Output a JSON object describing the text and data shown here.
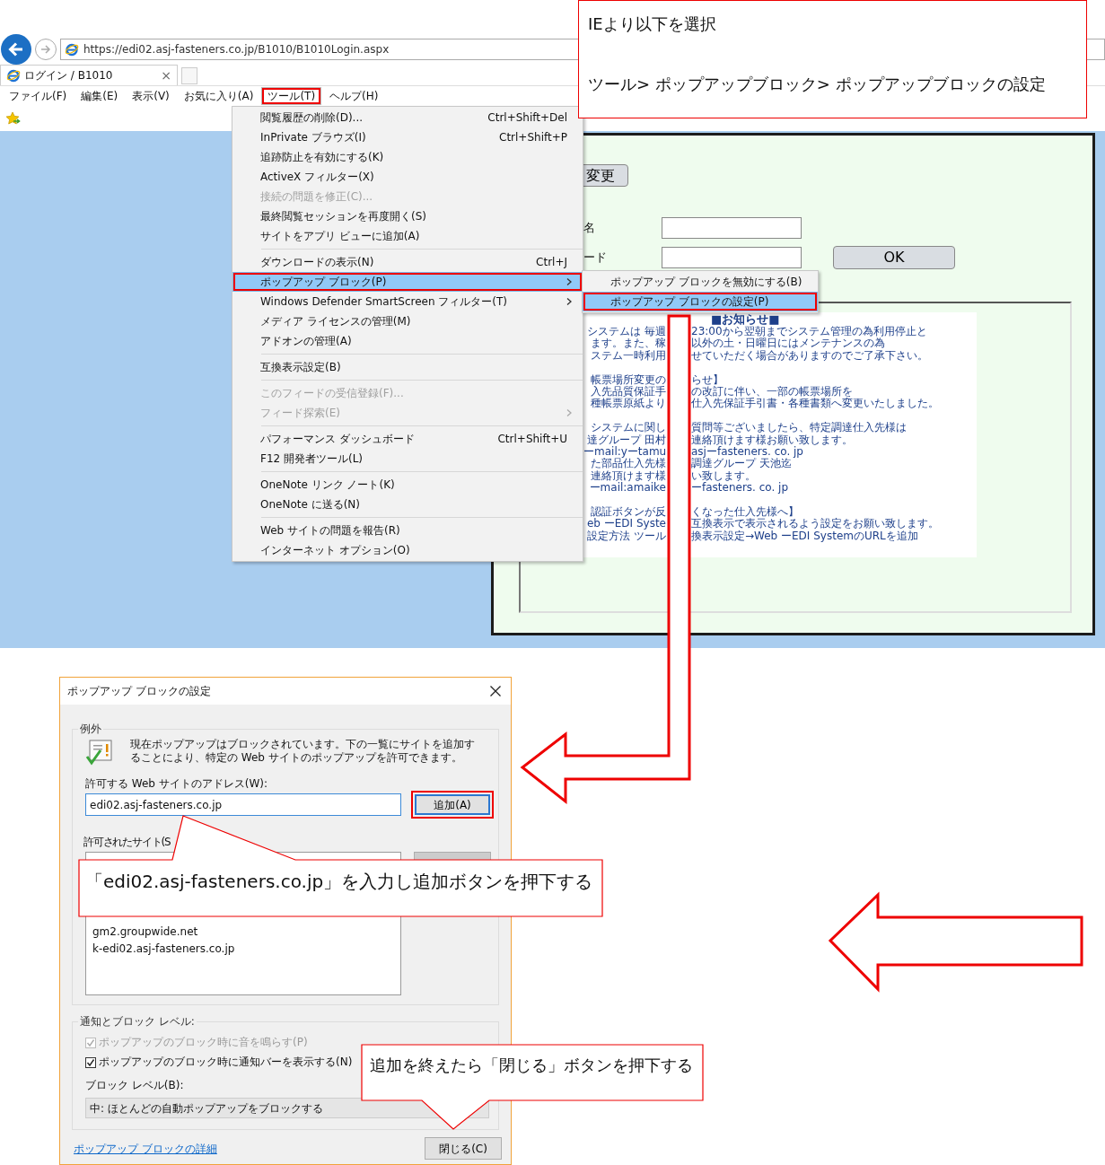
{
  "browser": {
    "address": "https://edi02.asj-fasteners.co.jp/B1010/B1010Login.aspx",
    "tab": {
      "title": "ログイン / B1010",
      "close": "×"
    },
    "menubar": [
      {
        "label": "ファイル(F)",
        "selected": false,
        "annotated": false
      },
      {
        "label": "編集(E)",
        "selected": false,
        "annotated": false
      },
      {
        "label": "表示(V)",
        "selected": false,
        "annotated": false
      },
      {
        "label": "お気に入り(A)",
        "selected": false,
        "annotated": false
      },
      {
        "label": "ツール(T)",
        "selected": true,
        "annotated": true
      },
      {
        "label": "ヘルプ(H)",
        "selected": false,
        "annotated": false
      }
    ],
    "tools_menu": [
      {
        "kind": "item",
        "label": "閲覧履歴の削除(D)...",
        "shortcut": "Ctrl+Shift+Del",
        "disabled": false,
        "selected": false,
        "submenu": false,
        "annotated": false
      },
      {
        "kind": "item",
        "label": "InPrivate ブラウズ(I)",
        "shortcut": "Ctrl+Shift+P",
        "disabled": false,
        "selected": false,
        "submenu": false,
        "annotated": false
      },
      {
        "kind": "item",
        "label": "追跡防止を有効にする(K)",
        "disabled": false,
        "selected": false,
        "submenu": false,
        "annotated": false
      },
      {
        "kind": "item",
        "label": "ActiveX フィルター(X)",
        "disabled": false,
        "selected": false,
        "submenu": false,
        "annotated": false
      },
      {
        "kind": "item",
        "label": "接続の問題を修正(C)...",
        "disabled": true,
        "selected": false,
        "submenu": false,
        "annotated": false
      },
      {
        "kind": "item",
        "label": "最終閲覧セッションを再度開く(S)",
        "disabled": false,
        "selected": false,
        "submenu": false,
        "annotated": false
      },
      {
        "kind": "item",
        "label": "サイトをアプリ ビューに追加(A)",
        "disabled": false,
        "selected": false,
        "submenu": false,
        "annotated": false
      },
      {
        "kind": "separator"
      },
      {
        "kind": "item",
        "label": "ダウンロードの表示(N)",
        "shortcut": "Ctrl+J",
        "disabled": false,
        "selected": false,
        "submenu": false,
        "annotated": false
      },
      {
        "kind": "item",
        "label": "ポップアップ ブロック(P)",
        "disabled": false,
        "selected": true,
        "submenu": true,
        "annotated": true
      },
      {
        "kind": "item",
        "label": "Windows Defender SmartScreen フィルター(T)",
        "disabled": false,
        "selected": false,
        "submenu": true,
        "annotated": false
      },
      {
        "kind": "item",
        "label": "メディア ライセンスの管理(M)",
        "disabled": false,
        "selected": false,
        "submenu": false,
        "annotated": false
      },
      {
        "kind": "item",
        "label": "アドオンの管理(A)",
        "disabled": false,
        "selected": false,
        "submenu": false,
        "annotated": false
      },
      {
        "kind": "separator"
      },
      {
        "kind": "item",
        "label": "互換表示設定(B)",
        "disabled": false,
        "selected": false,
        "submenu": false,
        "annotated": false
      },
      {
        "kind": "separator"
      },
      {
        "kind": "item",
        "label": "このフィードの受信登録(F)...",
        "disabled": true,
        "selected": false,
        "submenu": false,
        "annotated": false
      },
      {
        "kind": "item",
        "label": "フィード探索(E)",
        "disabled": true,
        "selected": false,
        "submenu": true,
        "annotated": false
      },
      {
        "kind": "separator"
      },
      {
        "kind": "item",
        "label": "パフォーマンス ダッシュボード",
        "shortcut": "Ctrl+Shift+U",
        "disabled": false,
        "selected": false,
        "submenu": false,
        "annotated": false
      },
      {
        "kind": "item",
        "label": "F12 開発者ツール(L)",
        "disabled": false,
        "selected": false,
        "submenu": false,
        "annotated": false
      },
      {
        "kind": "separator"
      },
      {
        "kind": "item",
        "label": "OneNote リンク ノート(K)",
        "disabled": false,
        "selected": false,
        "submenu": false,
        "annotated": false
      },
      {
        "kind": "item",
        "label": "OneNote に送る(N)",
        "disabled": false,
        "selected": false,
        "submenu": false,
        "annotated": false
      },
      {
        "kind": "separator"
      },
      {
        "kind": "item",
        "label": "Web サイトの問題を報告(R)",
        "disabled": false,
        "selected": false,
        "submenu": false,
        "annotated": false
      },
      {
        "kind": "item",
        "label": "インターネット オプション(O)",
        "disabled": false,
        "selected": false,
        "submenu": false,
        "annotated": false
      }
    ],
    "popup_submenu": [
      {
        "kind": "item",
        "label": "ポップアップ ブロックを無効にする(B)",
        "disabled": false,
        "selected": false,
        "submenu": false,
        "annotated": false
      },
      {
        "kind": "item",
        "label": "ポップアップ ブロックの設定(P)",
        "disabled": false,
        "selected": true,
        "submenu": false,
        "annotated": true
      }
    ]
  },
  "login_panel": {
    "change_button": "変更",
    "fields": [
      {
        "label": "名"
      },
      {
        "label": "ード"
      }
    ],
    "ok_button": "OK",
    "notice": {
      "title": "■お知らせ■",
      "paragraphs": [
        [
          {
            "left": "システムは 毎週",
            "right": "23:00から翌朝までシステム管理の為利用停止と"
          },
          {
            "left": "ます。また、稼",
            "right": "以外の土・日曜日にはメンテナンスの為"
          },
          {
            "left": "ステム一時利用",
            "right": "せていただく場合がありますのでご了承下さい。"
          }
        ],
        [
          {
            "left": "帳票場所変更の",
            "right": "らせ】"
          },
          {
            "left": "入先品質保証手",
            "right": "の改訂に伴い、一部の帳票場所を"
          },
          {
            "left": "種帳票原紙より",
            "right": "仕入先保証手引書・各種書類へ変更いたしました。"
          }
        ],
        [
          {
            "left": "システムに関し",
            "right": "質問等ございましたら、特定調達仕入先様は"
          },
          {
            "left": "達グループ 田村",
            "right": "連絡頂けます様お願い致します。"
          },
          {
            "left": "ーmail:yーtamu",
            "right": "asjーfasteners. co. jp"
          },
          {
            "left": "た部品仕入先様",
            "right": "調達グループ 天池迄"
          },
          {
            "left": "連絡頂けます様",
            "right": "い致します。"
          },
          {
            "left": "ーmail:amaike",
            "right": "ーfasteners. co. jp"
          }
        ],
        [
          {
            "left": "認証ボタンが反",
            "right": "くなった仕入先様へ】"
          },
          {
            "left": "eb ーEDI Syste",
            "right": "互換表示で表示されるよう設定をお願い致します。"
          },
          {
            "left": "設定方法 ツール",
            "right": "換表示設定→Web ーEDI SystemのURLを追加"
          }
        ]
      ]
    }
  },
  "dialog": {
    "title": "ポップアップ ブロックの設定",
    "exceptions": {
      "legend": "例外",
      "description": "現在ポップアップはブロックされています。下の一覧にサイトを追加することにより、特定の Web サイトのポップアップを許可できます。",
      "address_label": "許可する Web サイトのアドレス(W):",
      "address_value": "edi02.asj-fasteners.co.jp",
      "add_button": {
        "label": "追加(A)",
        "annotated": true
      },
      "allowed_label": "許可されたサイト(S",
      "allowed_sites": [
        "gm2.groupwide.net",
        "k-edi02.asj-fasteners.co.jp"
      ]
    },
    "notification": {
      "legend": "通知とブロック レベル:",
      "options": [
        {
          "label": "ポップアップのブロック時に音を鳴らす(P)",
          "checked": true,
          "disabled": true
        },
        {
          "label": "ポップアップのブロック時に通知バーを表示する(N)",
          "checked": true,
          "disabled": false
        }
      ],
      "level_label": "ブロック レベル(B):",
      "level_value": "中: ほとんどの自動ポップアップをブロックする"
    },
    "footer": {
      "link": "ポップアップ ブロックの詳細",
      "close_button": "閉じる(C)"
    }
  },
  "annotations": {
    "top_note": [
      "IEより以下を選択",
      "ツール> ポップアップブロック> ポップアップブロックの設定"
    ],
    "callouts": [
      "「edi02.asj-fasteners.co.jp」を入力し追加ボタンを押下する",
      "追加を終えたら「閉じる」ボタンを押下する"
    ]
  }
}
